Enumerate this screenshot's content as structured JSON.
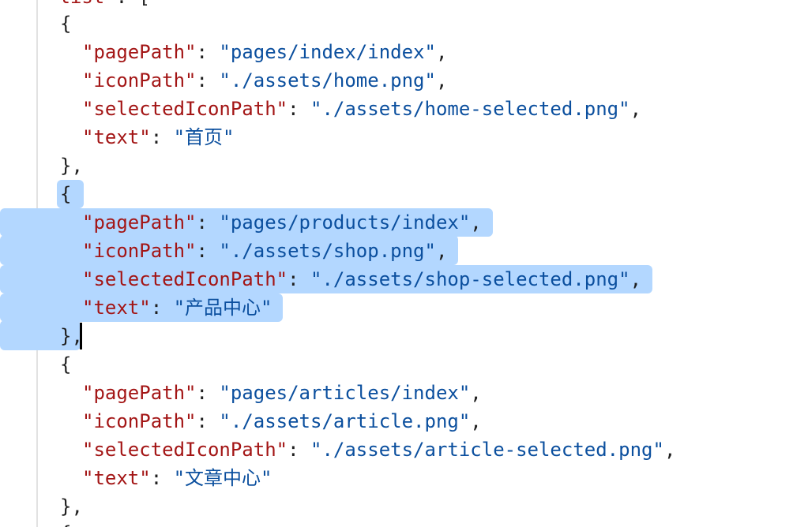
{
  "editor": {
    "top_partial": {
      "key": "\"list\"",
      "colon": ": ["
    },
    "objects": [
      {
        "open": "{",
        "fields": [
          {
            "key": "\"pagePath\"",
            "colon": ": ",
            "value": "\"pages/index/index\"",
            "comma": ","
          },
          {
            "key": "\"iconPath\"",
            "colon": ": ",
            "value": "\"./assets/home.png\"",
            "comma": ","
          },
          {
            "key": "\"selectedIconPath\"",
            "colon": ": ",
            "value": "\"./assets/home-selected.png\"",
            "comma": ","
          },
          {
            "key": "\"text\"",
            "colon": ": ",
            "value": "\"首页\"",
            "comma": ""
          }
        ],
        "close": "},"
      },
      {
        "open": "{",
        "fields": [
          {
            "key": "\"pagePath\"",
            "colon": ": ",
            "value": "\"pages/products/index\"",
            "comma": ","
          },
          {
            "key": "\"iconPath\"",
            "colon": ": ",
            "value": "\"./assets/shop.png\"",
            "comma": ","
          },
          {
            "key": "\"selectedIconPath\"",
            "colon": ": ",
            "value": "\"./assets/shop-selected.png\"",
            "comma": ","
          },
          {
            "key": "\"text\"",
            "colon": ": ",
            "value": "\"产品中心\"",
            "comma": ""
          }
        ],
        "close": "},"
      },
      {
        "open": "{",
        "fields": [
          {
            "key": "\"pagePath\"",
            "colon": ": ",
            "value": "\"pages/articles/index\"",
            "comma": ","
          },
          {
            "key": "\"iconPath\"",
            "colon": ": ",
            "value": "\"./assets/article.png\"",
            "comma": ","
          },
          {
            "key": "\"selectedIconPath\"",
            "colon": ": ",
            "value": "\"./assets/article-selected.png\"",
            "comma": ","
          },
          {
            "key": "\"text\"",
            "colon": ": ",
            "value": "\"文章中心\"",
            "comma": ""
          }
        ],
        "close": "},"
      }
    ],
    "bottom_partial": "{"
  }
}
